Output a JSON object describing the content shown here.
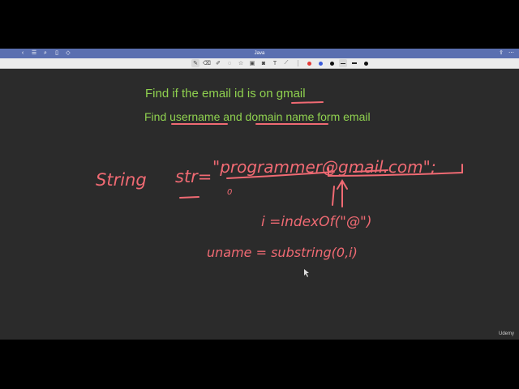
{
  "window": {
    "title": "Java",
    "nav_icons": [
      "chevron-left-icon",
      "list-icon",
      "search-icon",
      "bookmark-icon",
      "tag-icon"
    ],
    "right_icons": [
      "export-icon",
      "more-icon"
    ]
  },
  "toolbar": {
    "tools": [
      "pen-icon",
      "eraser-icon",
      "highlighter-icon",
      "lasso-icon",
      "shapes-icon",
      "image-icon",
      "camera-icon",
      "text-icon",
      "ruler-icon"
    ],
    "colors": [
      "#e53935",
      "#3b5bdb",
      "#111111"
    ],
    "stroke_sizes": [
      "thin",
      "medium"
    ]
  },
  "canvas": {
    "line1": {
      "before": "Find if the email id is on ",
      "underlined": "gmail"
    },
    "line2": {
      "p1": "Find ",
      "u1": "username",
      "p2": " and ",
      "u2": "domain name",
      "p3": " form email"
    },
    "handwriting": {
      "declaration_type": "String",
      "declaration_var": "str=",
      "string_literal": "\"programmer@gmail.com\";",
      "index_zero": "0",
      "index_expr": "i =indexOf(\"@\")",
      "uname_expr": "uname = substring(0,i)"
    },
    "ink_color": "#f06a73",
    "text_color": "#8fd14f"
  },
  "watermark": "Udemy"
}
